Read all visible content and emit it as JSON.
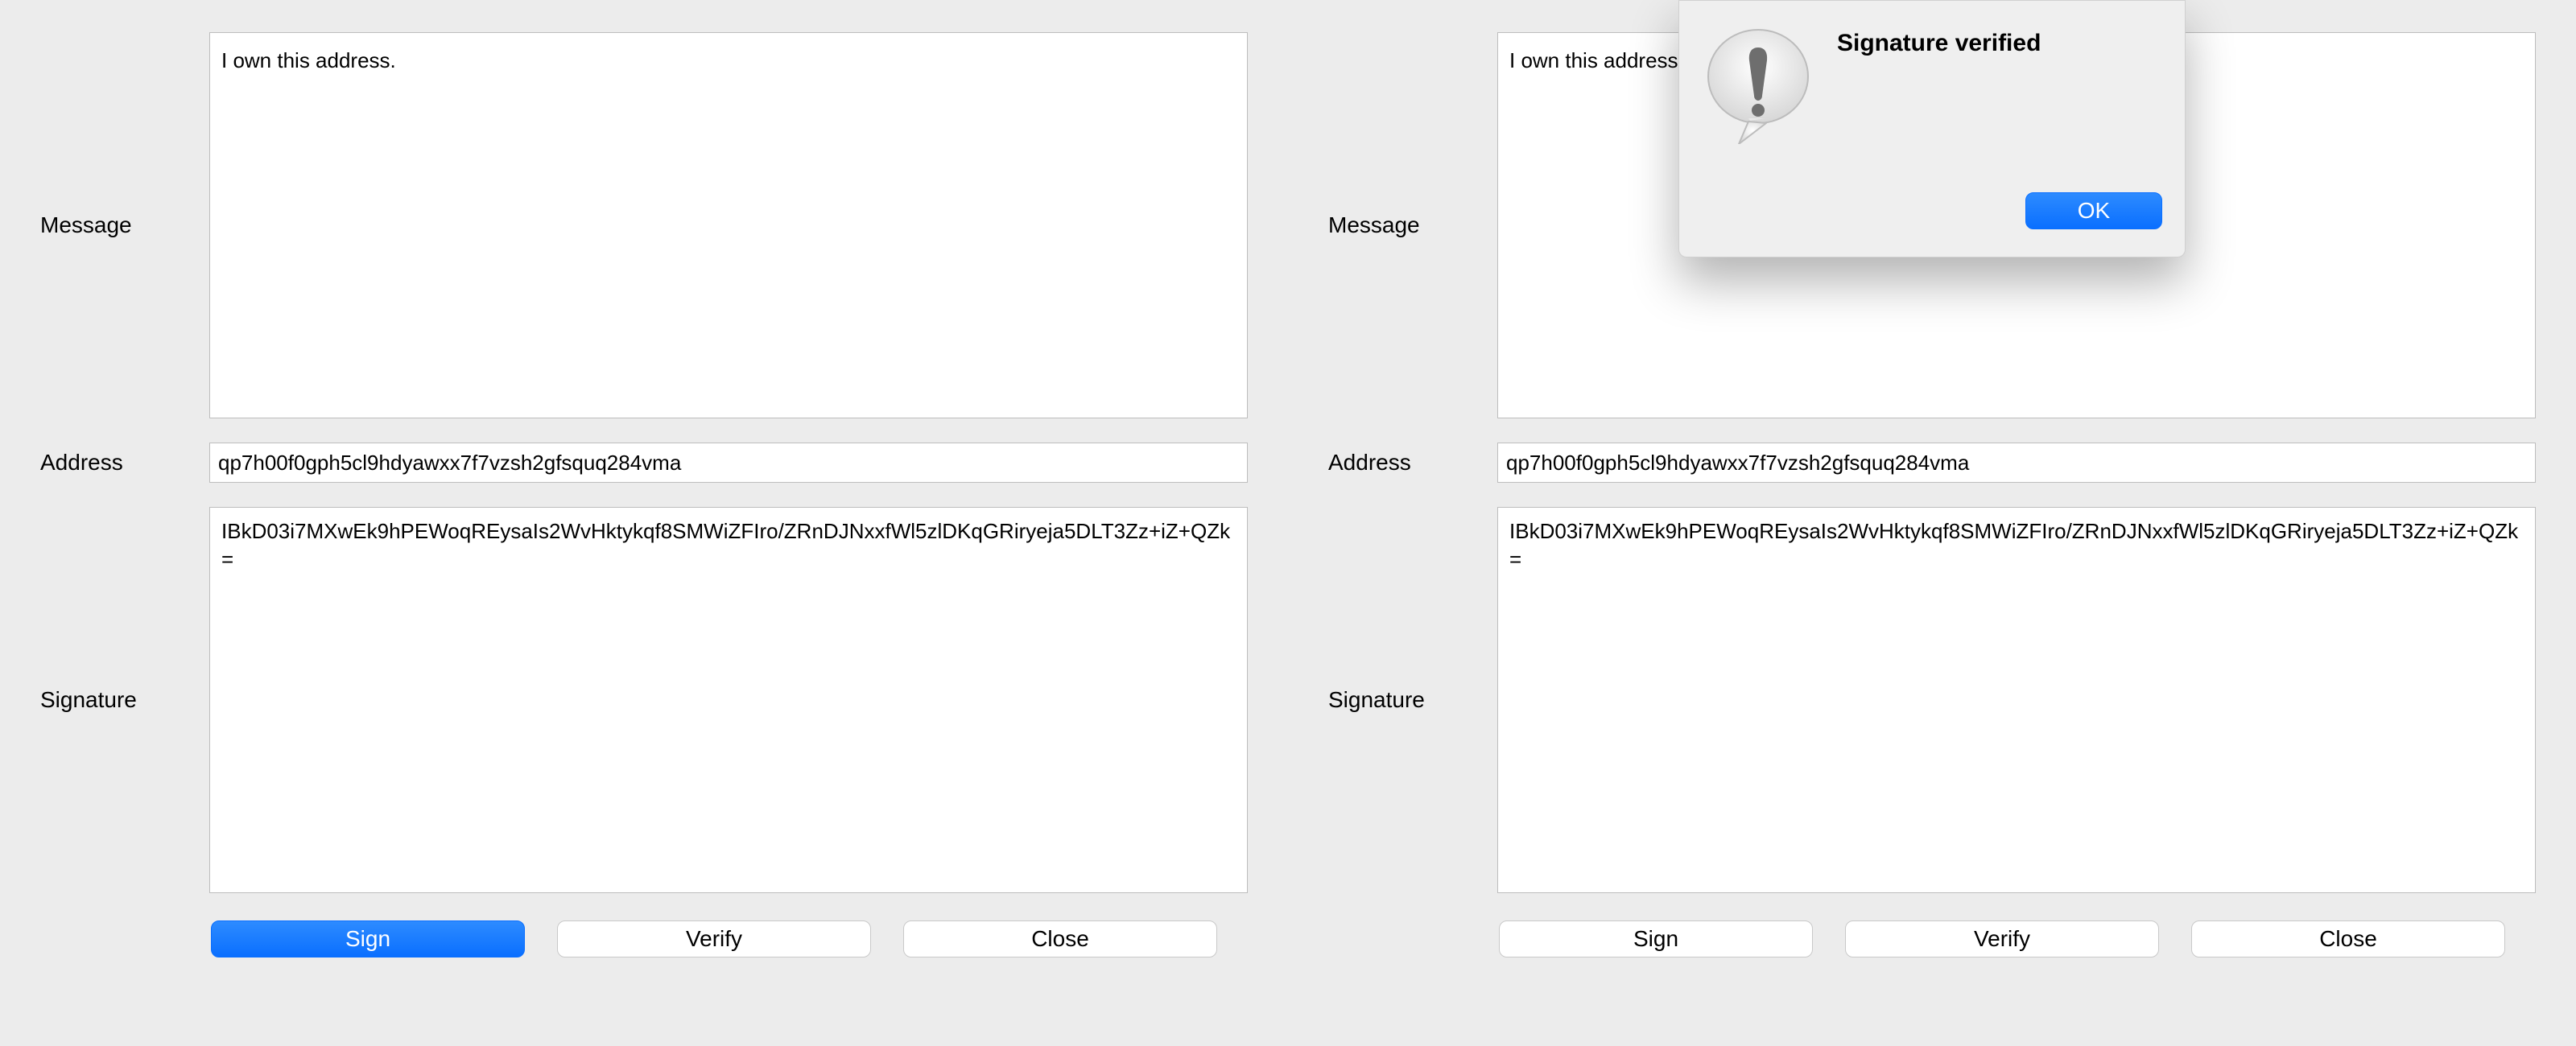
{
  "left": {
    "labels": {
      "message": "Message",
      "address": "Address",
      "signature": "Signature"
    },
    "fields": {
      "message": "I own this address.",
      "address": "qp7h00f0gph5cl9hdyawxx7f7vzsh2gfsquq284vma",
      "signature": "IBkD03i7MXwEk9hPEWoqREysaIs2WvHktykqf8SMWiZFIro/ZRnDJNxxfWl5zlDKqGRiryeja5DLT3Zz+iZ+QZk="
    },
    "buttons": {
      "sign": "Sign",
      "verify": "Verify",
      "close": "Close"
    }
  },
  "right": {
    "labels": {
      "message": "Message",
      "address": "Address",
      "signature": "Signature"
    },
    "fields": {
      "message": "I own this address.",
      "address": "qp7h00f0gph5cl9hdyawxx7f7vzsh2gfsquq284vma",
      "signature": "IBkD03i7MXwEk9hPEWoqREysaIs2WvHktykqf8SMWiZFIro/ZRnDJNxxfWl5zlDKqGRiryeja5DLT3Zz+iZ+QZk="
    },
    "buttons": {
      "sign": "Sign",
      "verify": "Verify",
      "close": "Close"
    },
    "dialog": {
      "title": "Signature verified",
      "ok": "OK"
    }
  }
}
